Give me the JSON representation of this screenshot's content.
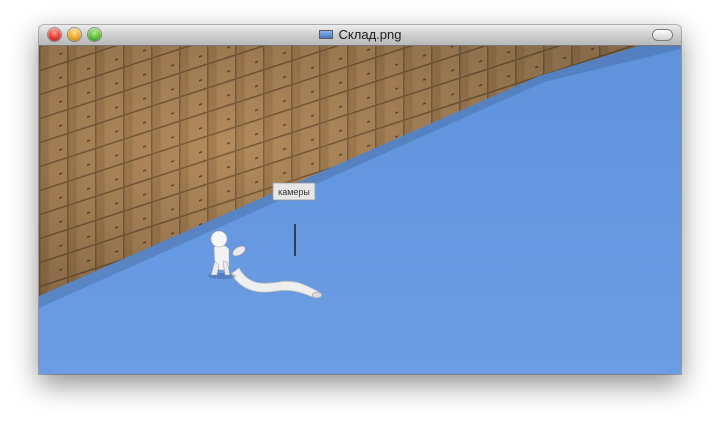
{
  "window": {
    "title": "Склад.png",
    "file_icon": "png-image-icon"
  },
  "scene": {
    "sign_text": "камеры",
    "floor_color": "#6a9be2",
    "box_color": "#b48c5e"
  }
}
